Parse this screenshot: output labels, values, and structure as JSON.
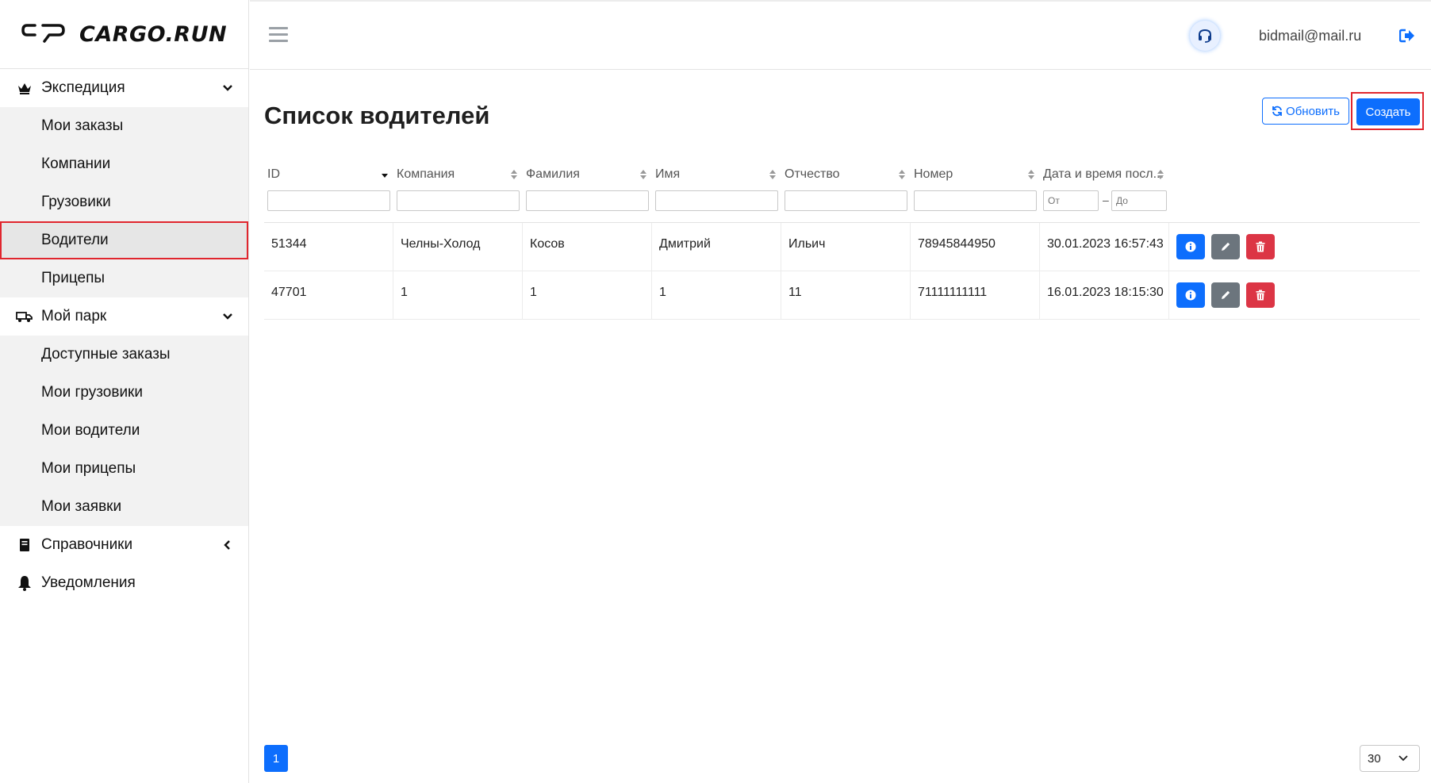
{
  "brand": {
    "name": "CARGO.RUN"
  },
  "sidebar": {
    "groups": [
      {
        "label": "Экспедиция",
        "icon": "crown-icon",
        "items": [
          "Мои заказы",
          "Компании",
          "Грузовики",
          "Водители",
          "Прицепы"
        ]
      },
      {
        "label": "Мой парк",
        "icon": "truck-icon",
        "items": [
          "Доступные заказы",
          "Мои грузовики",
          "Мои водители",
          "Мои прицепы",
          "Мои заявки"
        ]
      },
      {
        "label": "Справочники",
        "icon": "book-icon"
      },
      {
        "label": "Уведомления",
        "icon": "bell-icon"
      }
    ],
    "active_item": "Водители"
  },
  "header": {
    "email": "bidmail@mail.ru"
  },
  "main": {
    "title": "Список водителей",
    "refresh_label": "Обновить",
    "create_label": "Создать",
    "columns": [
      "ID",
      "Компания",
      "Фамилия",
      "Имя",
      "Отчество",
      "Номер",
      "Дата и время посл..."
    ],
    "date_from_placeholder": "От",
    "date_to_placeholder": "До",
    "date_dash": "–",
    "rows": [
      [
        "51344",
        "Челны-Холод",
        "Косов",
        "Дмитрий",
        "Ильич",
        "78945844950",
        "30.01.2023 16:57:43"
      ],
      [
        "47701",
        "1",
        "1",
        "1",
        "11",
        "71111111111",
        "16.01.2023 18:15:30"
      ]
    ]
  },
  "pagination": {
    "current_page": "1",
    "per_page": "30"
  },
  "colors": {
    "primary": "#0d6efd",
    "danger": "#dc3545",
    "secondary": "#6c757d",
    "highlight": "#e0262e"
  }
}
